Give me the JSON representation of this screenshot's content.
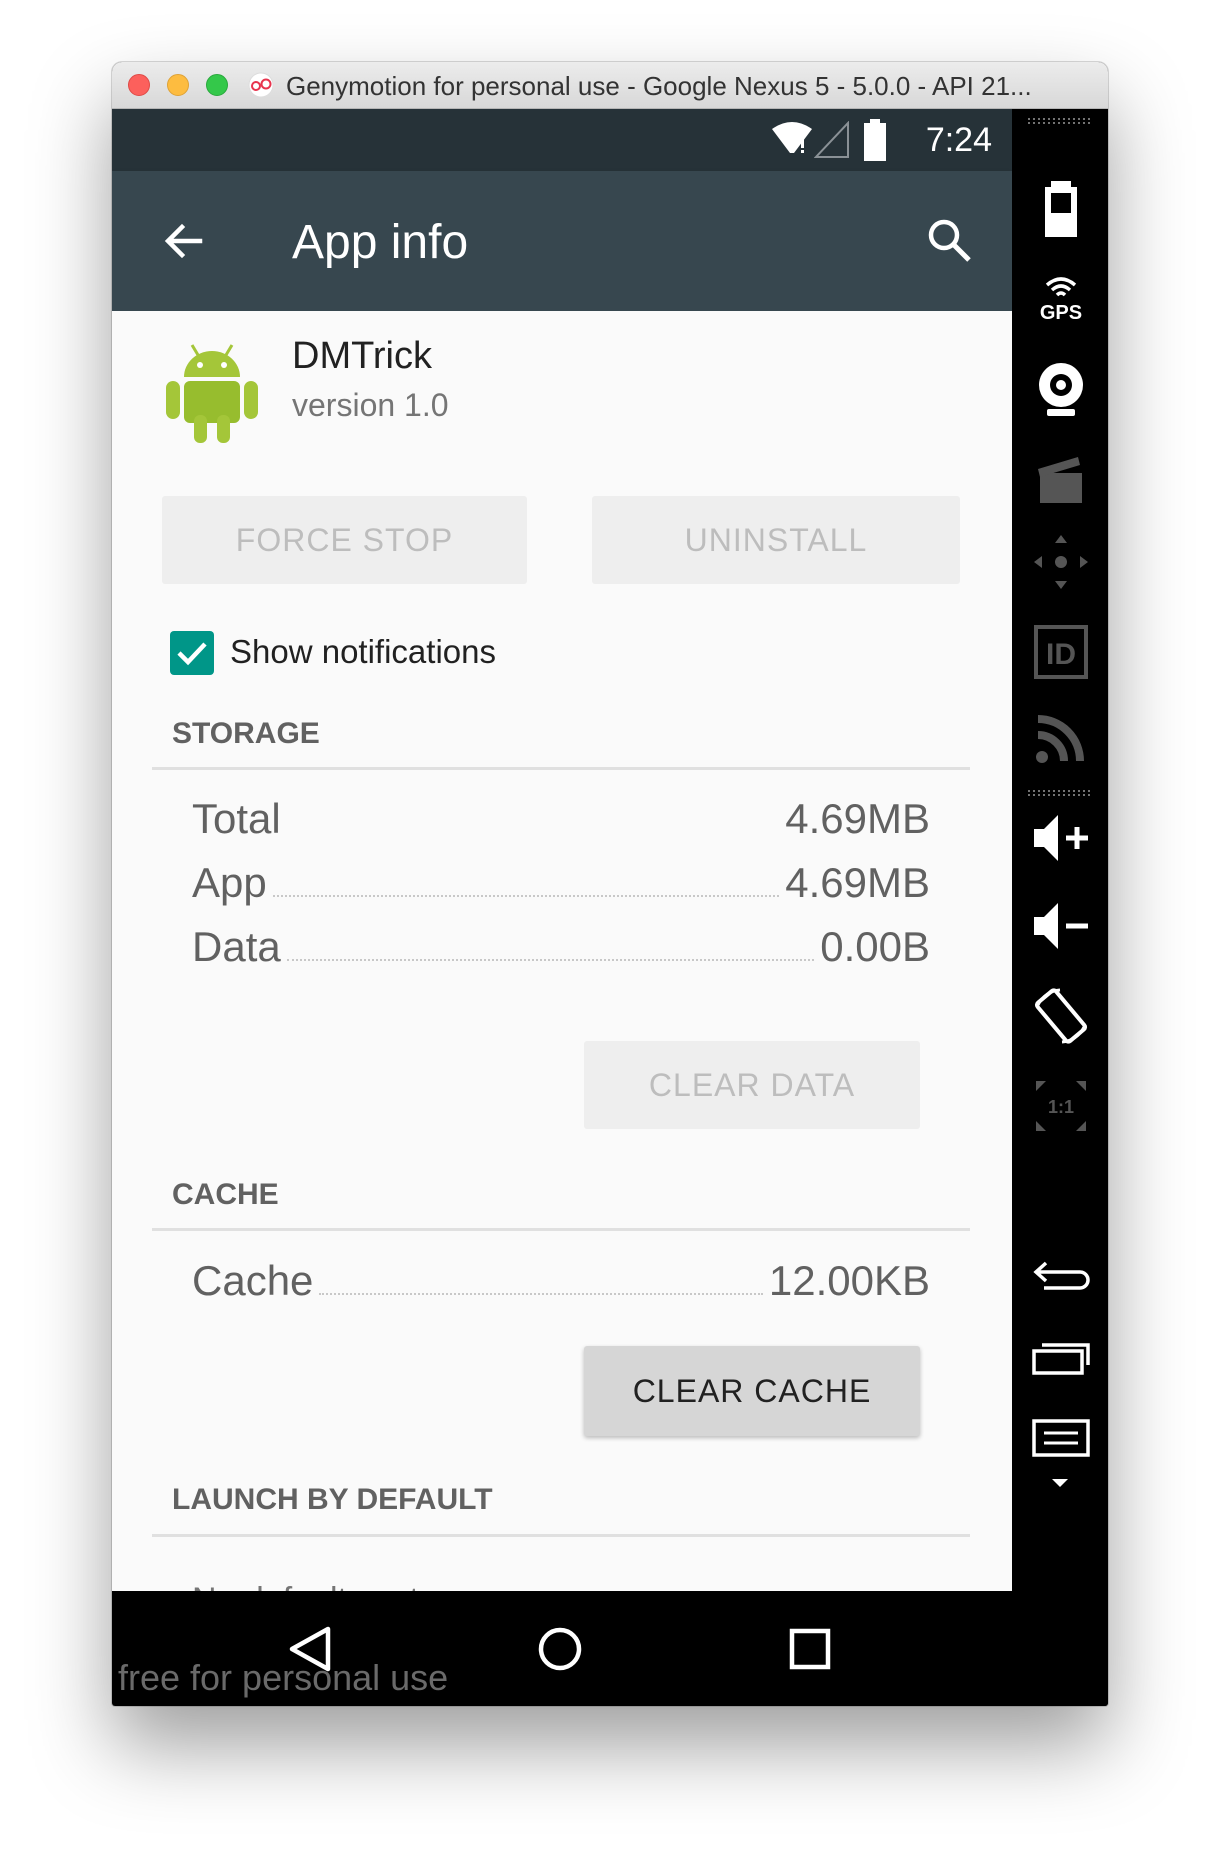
{
  "window": {
    "title": "Genymotion for personal use - Google Nexus 5 - 5.0.0 - API 21..."
  },
  "status_bar": {
    "time": "7:24",
    "icons": [
      "wifi-icon",
      "signal-icon",
      "battery-icon"
    ]
  },
  "app_bar": {
    "title": "App info",
    "back_icon": "arrow-back-icon",
    "search_icon": "search-icon"
  },
  "app": {
    "name": "DMTrick",
    "version": "version 1.0",
    "icon": "android-robot-icon"
  },
  "actions": {
    "force_stop": "FORCE STOP",
    "uninstall": "UNINSTALL"
  },
  "notifications": {
    "label": "Show notifications",
    "checked": true
  },
  "storage": {
    "header": "STORAGE",
    "rows": [
      {
        "label": "Total",
        "value": "4.69MB"
      },
      {
        "label": "App",
        "value": "4.69MB"
      },
      {
        "label": "Data",
        "value": "0.00B"
      }
    ],
    "clear_data": "CLEAR DATA"
  },
  "cache": {
    "header": "CACHE",
    "rows": [
      {
        "label": "Cache",
        "value": "12.00KB"
      }
    ],
    "clear_cache": "CLEAR CACHE"
  },
  "launch": {
    "header": "LAUNCH BY DEFAULT",
    "partial_text": "No defaults set."
  },
  "nav_bar": {
    "watermark": "free for personal use",
    "icons": [
      "nav-back-icon",
      "nav-home-icon",
      "nav-recents-icon"
    ]
  },
  "toolbar": {
    "icons": [
      "battery-widget-icon",
      "gps-widget-icon",
      "camera-widget-icon",
      "capture-widget-icon",
      "remote-control-icon",
      "device-id-icon",
      "rss-icon",
      "volume-up-icon",
      "volume-down-icon",
      "rotate-icon",
      "pixel-perfect-icon",
      "back-key-icon",
      "recent-apps-key-icon",
      "menu-key-icon"
    ],
    "gps_label": "GPS",
    "id_label": "ID",
    "ratio_label": "1:1"
  },
  "colors": {
    "status_bar": "#263238",
    "app_bar": "#37474f",
    "checkbox": "#009688",
    "android_green": "#a4c639"
  }
}
